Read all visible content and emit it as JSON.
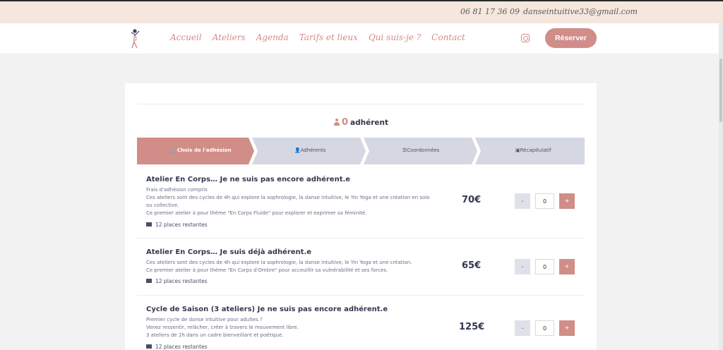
{
  "topbar": {
    "phone": "06 81 17 36 09",
    "email": "danseintuitive33@gmail.com"
  },
  "nav": {
    "items": [
      "Accueil",
      "Ateliers",
      "Agenda",
      "Tarifs et lieux",
      "Qui suis-je ?",
      "Contact"
    ],
    "reserve_label": "Réserver"
  },
  "adherent": {
    "count": "0",
    "label": "adhérent"
  },
  "steps": [
    {
      "label": "Choix de l'adhésion",
      "active": true
    },
    {
      "label": "Adhérents",
      "active": false
    },
    {
      "label": "Coordonnées",
      "active": false
    },
    {
      "label": "Récapitulatif",
      "active": false
    }
  ],
  "products": [
    {
      "title": "Atelier En Corps… Je ne suis pas encore adhérent.e",
      "lines": [
        "Frais d'adhésion compris",
        "Ces ateliers sont des cycles de 4h qui explore la sophrologie, la danse intuitive, le Yin Yoga et une création en solo ou collective.",
        "Ce premier atelier à pour thème \"En Corps Fluide\" pour explorer et exprimer sa féminité."
      ],
      "places": "12 places restantes",
      "price": "70€",
      "qty": "0"
    },
    {
      "title": "Atelier En Corps… Je suis déjà adhérent.e",
      "lines": [
        "Ces ateliers sont des cycles de 4h qui explore la sophrologie, la danse intuitive, le Yin Yoga et une création.",
        "Ce premier atelier à pour thème \"En Corps d'Ombre\" pour acceuillir sa vulnérabilité et ses forces."
      ],
      "places": "12 places restantes",
      "price": "65€",
      "qty": "0"
    },
    {
      "title": "Cycle de Saison (3 ateliers) Je ne suis pas encore adhérent.e",
      "lines": [
        "Premier cycle de danse intuitive pour adultes ?",
        "Venez ressentir, relâcher, créer à travers le mouvement libre.",
        "3 ateliers de 2h dans un cadre bienveillant et poétique."
      ],
      "places": "12 places restantes",
      "price": "125€",
      "qty": "0"
    }
  ],
  "buttons": {
    "minus": "-",
    "plus": "+"
  },
  "colors": {
    "accent": "#d18d88",
    "topbar": "#f5e7de",
    "step_inactive": "#d5d8e2",
    "text": "#34384f"
  }
}
